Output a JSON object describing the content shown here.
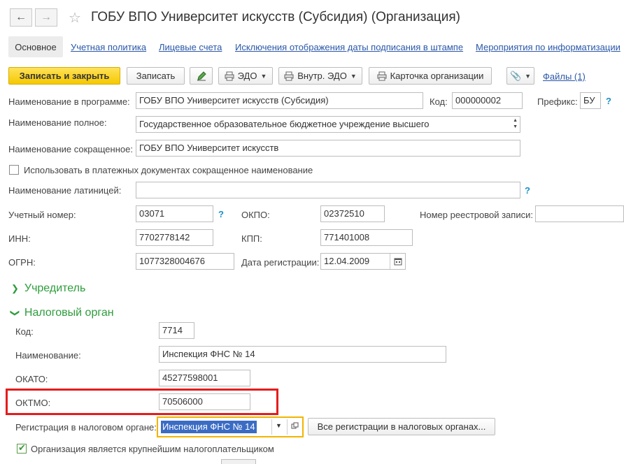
{
  "window": {
    "title": "ГОБУ ВПО Университет искусств (Субсидия) (Организация)",
    "back_icon": "arrow-left-icon",
    "forward_icon": "arrow-right-icon",
    "favorite_icon": "star-icon"
  },
  "tabs": [
    {
      "label": "Основное"
    },
    {
      "label": "Учетная политика"
    },
    {
      "label": "Лицевые счета"
    },
    {
      "label": "Исключения отображения даты подписания в штампе"
    },
    {
      "label": "Мероприятия по информатизации"
    }
  ],
  "toolbar": {
    "save_close": "Записать и закрыть",
    "save": "Записать",
    "edo": "ЭДО",
    "internal_edo": "Внутр. ЭДО",
    "org_card": "Карточка организации",
    "files": "Файлы (1)",
    "more": "..."
  },
  "form": {
    "name_program_label": "Наименование в программе:",
    "name_program_value": "ГОБУ ВПО Университет искусств (Субсидия)",
    "code_label": "Код:",
    "code_value": "000000002",
    "prefix_label": "Префикс:",
    "prefix_value": "БУ",
    "full_name_label": "Наименование полное:",
    "full_name_value": "Государственное образовательное бюджетное учреждение высшего",
    "short_name_label": "Наименование сокращенное:",
    "short_name_value": "ГОБУ ВПО Университет искусств",
    "use_short_label": "Использовать в платежных документах сокращенное наименование",
    "latin_label": "Наименование латиницей:",
    "latin_value": "",
    "account_no_label": "Учетный номер:",
    "account_no_value": "03071",
    "okpo_label": "ОКПО:",
    "okpo_value": "02372510",
    "registry_no_label": "Номер реестровой записи:",
    "registry_no_value": "",
    "inn_label": "ИНН:",
    "inn_value": "7702778142",
    "kpp_label": "КПП:",
    "kpp_value": "771401008",
    "ogrn_label": "ОГРН:",
    "ogrn_value": "1077328004676",
    "reg_date_label": "Дата регистрации:",
    "reg_date_value": "12.04.2009",
    "help": "?"
  },
  "sections": {
    "founder": "Учредитель",
    "tax_authority": "Налоговый орган"
  },
  "tax": {
    "code_label": "Код:",
    "code_value": "7714",
    "name_label": "Наименование:",
    "name_value": "Инспекция ФНС № 14",
    "okato_label": "ОКАТО:",
    "okato_value": "45277598001",
    "oktmo_label": "ОКТМО:",
    "oktmo_value": "70506000",
    "registration_label": "Регистрация в налоговом органе:",
    "registration_value": "Инспекция ФНС № 14",
    "all_registrations": "Все регистрации в налоговых органах...",
    "largest_taxpayer_label": "Организация является крупнейшим налогоплательщиком"
  },
  "colors": {
    "accent_green": "#2e9c3c",
    "highlight_red": "#e51c1c",
    "primary_yellow": "#f5c800",
    "link_blue": "#2a57a8"
  }
}
